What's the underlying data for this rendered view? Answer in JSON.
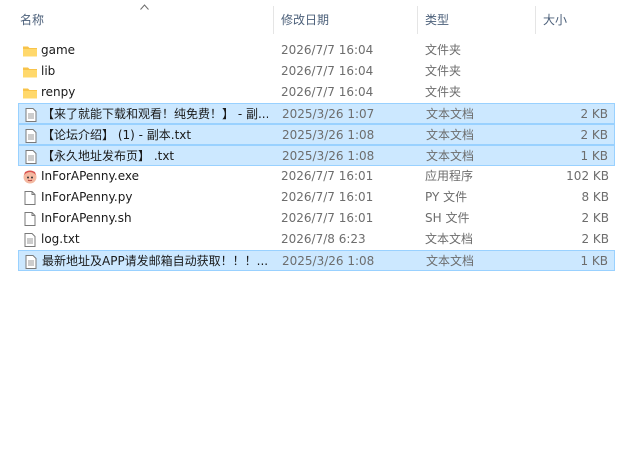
{
  "columns": {
    "name": "名称",
    "modified": "修改日期",
    "type": "类型",
    "size": "大小"
  },
  "files": [
    {
      "icon": "folder-icon",
      "name": "game",
      "modified": "2026/7/7 16:04",
      "type": "文件夹",
      "size": "",
      "selected": false
    },
    {
      "icon": "folder-icon",
      "name": "lib",
      "modified": "2026/7/7 16:04",
      "type": "文件夹",
      "size": "",
      "selected": false
    },
    {
      "icon": "folder-icon",
      "name": "renpy",
      "modified": "2026/7/7 16:04",
      "type": "文件夹",
      "size": "",
      "selected": false
    },
    {
      "icon": "text-file-icon",
      "name": "【来了就能下载和观看！纯免费！】 - 副...",
      "modified": "2025/3/26 1:07",
      "type": "文本文档",
      "size": "2 KB",
      "selected": true
    },
    {
      "icon": "text-file-icon",
      "name": "【论坛介绍】 (1) - 副本.txt",
      "modified": "2025/3/26 1:08",
      "type": "文本文档",
      "size": "2 KB",
      "selected": true
    },
    {
      "icon": "text-file-icon",
      "name": "【永久地址发布页】 .txt",
      "modified": "2025/3/26 1:08",
      "type": "文本文档",
      "size": "1 KB",
      "selected": true
    },
    {
      "icon": "app-exe-icon",
      "name": "InForAPenny.exe",
      "modified": "2026/7/7 16:01",
      "type": "应用程序",
      "size": "102 KB",
      "selected": false
    },
    {
      "icon": "file-icon",
      "name": "InForAPenny.py",
      "modified": "2026/7/7 16:01",
      "type": "PY 文件",
      "size": "8 KB",
      "selected": false
    },
    {
      "icon": "file-icon",
      "name": "InForAPenny.sh",
      "modified": "2026/7/7 16:01",
      "type": "SH 文件",
      "size": "2 KB",
      "selected": false
    },
    {
      "icon": "text-file-icon",
      "name": "log.txt",
      "modified": "2026/7/8 6:23",
      "type": "文本文档",
      "size": "2 KB",
      "selected": false
    },
    {
      "icon": "text-file-icon",
      "name": "最新地址及APP请发邮箱自动获取！！！...",
      "modified": "2025/3/26 1:08",
      "type": "文本文档",
      "size": "1 KB",
      "selected": true
    }
  ],
  "colors": {
    "selected_bg": "#cce8ff",
    "selected_border": "#99d1ff",
    "folder": "#ffd86b",
    "header_text": "#4c607a"
  }
}
